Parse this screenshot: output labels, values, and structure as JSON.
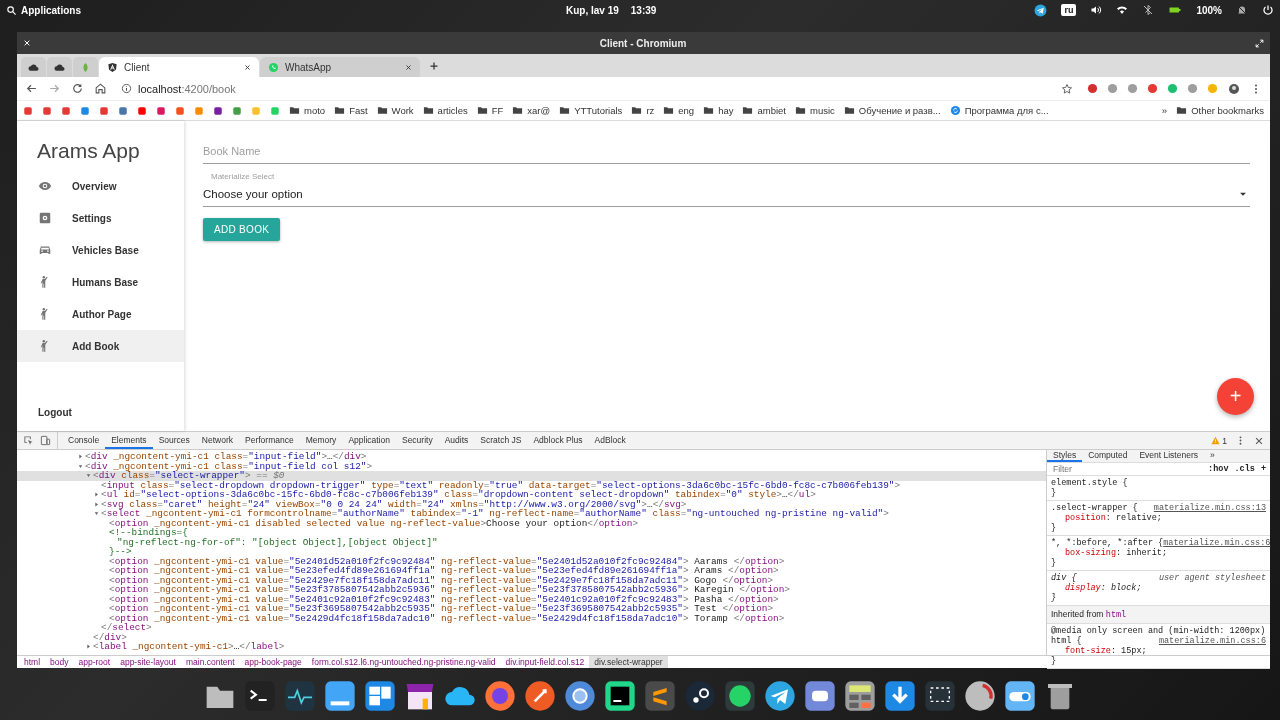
{
  "top_panel": {
    "menu": "Applications",
    "date": "Kup, Iav 19",
    "time": "13:39",
    "keyboard_layout": "ru",
    "battery": "100%"
  },
  "window": {
    "title": "Client - Chromium"
  },
  "tabs": [
    {
      "label": "Client",
      "selected": true
    },
    {
      "label": "WhatsApp",
      "selected": false
    }
  ],
  "address_bar": {
    "host": "localhost",
    "path": ":4200/book"
  },
  "bookmarks": {
    "items": [
      {
        "kind": "folder",
        "label": "moto"
      },
      {
        "kind": "folder",
        "label": "Fast"
      },
      {
        "kind": "folder",
        "label": "Work"
      },
      {
        "kind": "folder",
        "label": "articles"
      },
      {
        "kind": "folder",
        "label": "FF"
      },
      {
        "kind": "folder",
        "label": "xar@"
      },
      {
        "kind": "folder",
        "label": "YTTutorials"
      },
      {
        "kind": "folder",
        "label": "rz"
      },
      {
        "kind": "folder",
        "label": "eng"
      },
      {
        "kind": "folder",
        "label": "hay"
      },
      {
        "kind": "folder",
        "label": "ambiet"
      },
      {
        "kind": "folder",
        "label": "music"
      },
      {
        "kind": "folder",
        "label": "Обучение и разв..."
      },
      {
        "kind": "page",
        "label": "Программа для с..."
      }
    ],
    "overflow": "»",
    "other": "Other bookmarks"
  },
  "app": {
    "title": "Arams App",
    "nav": [
      {
        "label": "Overview",
        "selected": false
      },
      {
        "label": "Settings",
        "selected": false
      },
      {
        "label": "Vehicles Base",
        "selected": false
      },
      {
        "label": "Humans Base",
        "selected": false
      },
      {
        "label": "Author Page",
        "selected": false
      },
      {
        "label": "Add Book",
        "selected": true
      }
    ],
    "logout": "Logout",
    "book_name": {
      "placeholder": "Book Name"
    },
    "select": {
      "label": "Materialize Select",
      "value": "Choose your option"
    },
    "submit": "ADD BOOK",
    "fab": "+"
  },
  "devtools": {
    "tabs": [
      {
        "label": "Console",
        "selected": false
      },
      {
        "label": "Elements",
        "selected": true
      },
      {
        "label": "Sources",
        "selected": false
      },
      {
        "label": "Network",
        "selected": false
      },
      {
        "label": "Performance",
        "selected": false
      },
      {
        "label": "Memory",
        "selected": false
      },
      {
        "label": "Application",
        "selected": false
      },
      {
        "label": "Security",
        "selected": false
      },
      {
        "label": "Audits",
        "selected": false
      },
      {
        "label": "Scratch JS",
        "selected": false
      },
      {
        "label": "Adblock Plus",
        "selected": false
      },
      {
        "label": "AdBlock",
        "selected": false
      }
    ],
    "warnings": "1",
    "dom": [
      {
        "kind": "tag",
        "text": "<div _ngcontent-ymi-c1 class=\"input-field\">…</div>",
        "expanded": false,
        "selected": false
      },
      {
        "kind": "tag",
        "text": "<div _ngcontent-ymi-c1 class=\"input-field col s12\">",
        "expanded": true,
        "selected": false,
        "children": [
          {
            "kind": "tag",
            "text": "<div class=\"select-wrapper\">",
            "marker": "== $0",
            "expanded": true,
            "selected": true,
            "children": [
              {
                "kind": "plain",
                "text": "<input class=\"select-dropdown dropdown-trigger\" type=\"text\" readonly=\"true\" data-target=\"select-options-3da6c0bc-15fc-6bd0-fc8c-c7b006feb139\">",
                "selected": false
              },
              {
                "kind": "tag",
                "text": "<ul id=\"select-options-3da6c0bc-15fc-6bd0-fc8c-c7b006feb139\" class=\"dropdown-content select-dropdown\" tabindex=\"0\" style>…</ul>",
                "expanded": false,
                "selected": false
              },
              {
                "kind": "tag",
                "text": "<svg class=\"caret\" height=\"24\" viewBox=\"0 0 24 24\" width=\"24\" xmlns=\"http://www.w3.org/2000/svg\">…</svg>",
                "expanded": false,
                "selected": false
              },
              {
                "kind": "tag",
                "text": "<select _ngcontent-ymi-c1 formcontrolname=\"authorName\" tabindex=\"-1\" ng-reflect-name=\"authorName\" class=\"ng-untouched ng-pristine ng-valid\">",
                "expanded": true,
                "selected": false,
                "children": [
                  {
                    "kind": "plain",
                    "text": "<option _ngcontent-ymi-c1 disabled selected value ng-reflect-value>Choose your option</option>",
                    "selected": false
                  },
                  {
                    "kind": "comment",
                    "text": "<!--bindings={",
                    "selected": false,
                    "children": [
                      {
                        "kind": "comment",
                        "text": "\"ng-reflect-ng-for-of\": \"[object Object],[object Object]\"",
                        "selected": false
                      }
                    ]
                  },
                  {
                    "kind": "comment",
                    "text": "}-->",
                    "selected": false
                  },
                  {
                    "kind": "plain",
                    "text": "<option _ngcontent-ymi-c1 value=\"5e2401d52a010f2fc9c92484\" ng-reflect-value=\"5e2401d52a010f2fc9c92484\"> Aarams </option>",
                    "selected": false
                  },
                  {
                    "kind": "plain",
                    "text": "<option _ngcontent-ymi-c1 value=\"5e23efed4fd89e261694ff1a\" ng-reflect-value=\"5e23efed4fd89e261694ff1a\"> Arams </option>",
                    "selected": false
                  },
                  {
                    "kind": "plain",
                    "text": "<option _ngcontent-ymi-c1 value=\"5e2429e7fc18f158da7adc11\" ng-reflect-value=\"5e2429e7fc18f158da7adc11\"> Gogo </option>",
                    "selected": false
                  },
                  {
                    "kind": "plain",
                    "text": "<option _ngcontent-ymi-c1 value=\"5e23f3785807542abb2c5936\" ng-reflect-value=\"5e23f3785807542abb2c5936\"> Karegin </option>",
                    "selected": false
                  },
                  {
                    "kind": "plain",
                    "text": "<option _ngcontent-ymi-c1 value=\"5e2401c92a010f2fc9c92483\" ng-reflect-value=\"5e2401c92a010f2fc9c92483\"> Pasha </option>",
                    "selected": false
                  },
                  {
                    "kind": "plain",
                    "text": "<option _ngcontent-ymi-c1 value=\"5e23f3695807542abb2c5935\" ng-reflect-value=\"5e23f3695807542abb2c5935\"> Test </option>",
                    "selected": false
                  },
                  {
                    "kind": "plain",
                    "text": "<option _ngcontent-ymi-c1 value=\"5e2429d4fc18f158da7adc10\" ng-reflect-value=\"5e2429d4fc18f158da7adc10\"> Toramp </option>",
                    "selected": false
                  }
                ]
              },
              {
                "kind": "plain",
                "text": "</select>",
                "selected": false
              }
            ]
          },
          {
            "kind": "plain",
            "text": "</div>",
            "selected": false
          },
          {
            "kind": "tag",
            "text": "<label _ngcontent-ymi-c1>…</label>",
            "expanded": false,
            "selected": false
          }
        ]
      }
    ],
    "styles_tabs": [
      {
        "label": "Styles",
        "selected": true
      },
      {
        "label": "Computed",
        "selected": false
      },
      {
        "label": "Event Listeners",
        "selected": false
      }
    ],
    "styles_overflow": "»",
    "filter": {
      "placeholder": "Filter"
    },
    "hov": ":hov",
    "cls": ".cls",
    "add_rule": "+",
    "rules": [
      {
        "kind": "inline",
        "selector": "element.style {",
        "close": "}"
      },
      {
        "kind": "author",
        "selector": ".select-wrapper {",
        "source": "materialize.min.css:13",
        "declarations": [
          "position: relative;"
        ],
        "close": "}"
      },
      {
        "kind": "author",
        "selector": "*, *:before, *:after {",
        "source": "materialize.min.css:6",
        "declarations": [
          "box-sizing: inherit;"
        ],
        "close": "}"
      },
      {
        "kind": "agent",
        "selector": "div {",
        "source": "user agent stylesheet",
        "declarations": [
          "display: block;"
        ],
        "close": "}"
      },
      {
        "kind": "inherited",
        "label": "Inherited from",
        "element": "html"
      },
      {
        "kind": "author",
        "media": "@media only screen and (min-width: 1200px)",
        "selector": "html {",
        "source": "materialize.min.css:6",
        "declarations": [
          "font-size: 15px;"
        ],
        "close": "}"
      }
    ],
    "breadcrumbs": [
      {
        "label": "html",
        "selected": false
      },
      {
        "label": "body",
        "selected": false
      },
      {
        "label": "app-root",
        "selected": false
      },
      {
        "label": "app-site-layout",
        "selected": false
      },
      {
        "label": "main.content",
        "selected": false
      },
      {
        "label": "app-book-page",
        "selected": false
      },
      {
        "label": "form.col.s12.l6.ng-untouched.ng-pristine.ng-valid",
        "selected": false
      },
      {
        "label": "div.input-field.col.s12",
        "selected": false
      },
      {
        "label": "div.select-wrapper",
        "selected": true
      }
    ]
  }
}
